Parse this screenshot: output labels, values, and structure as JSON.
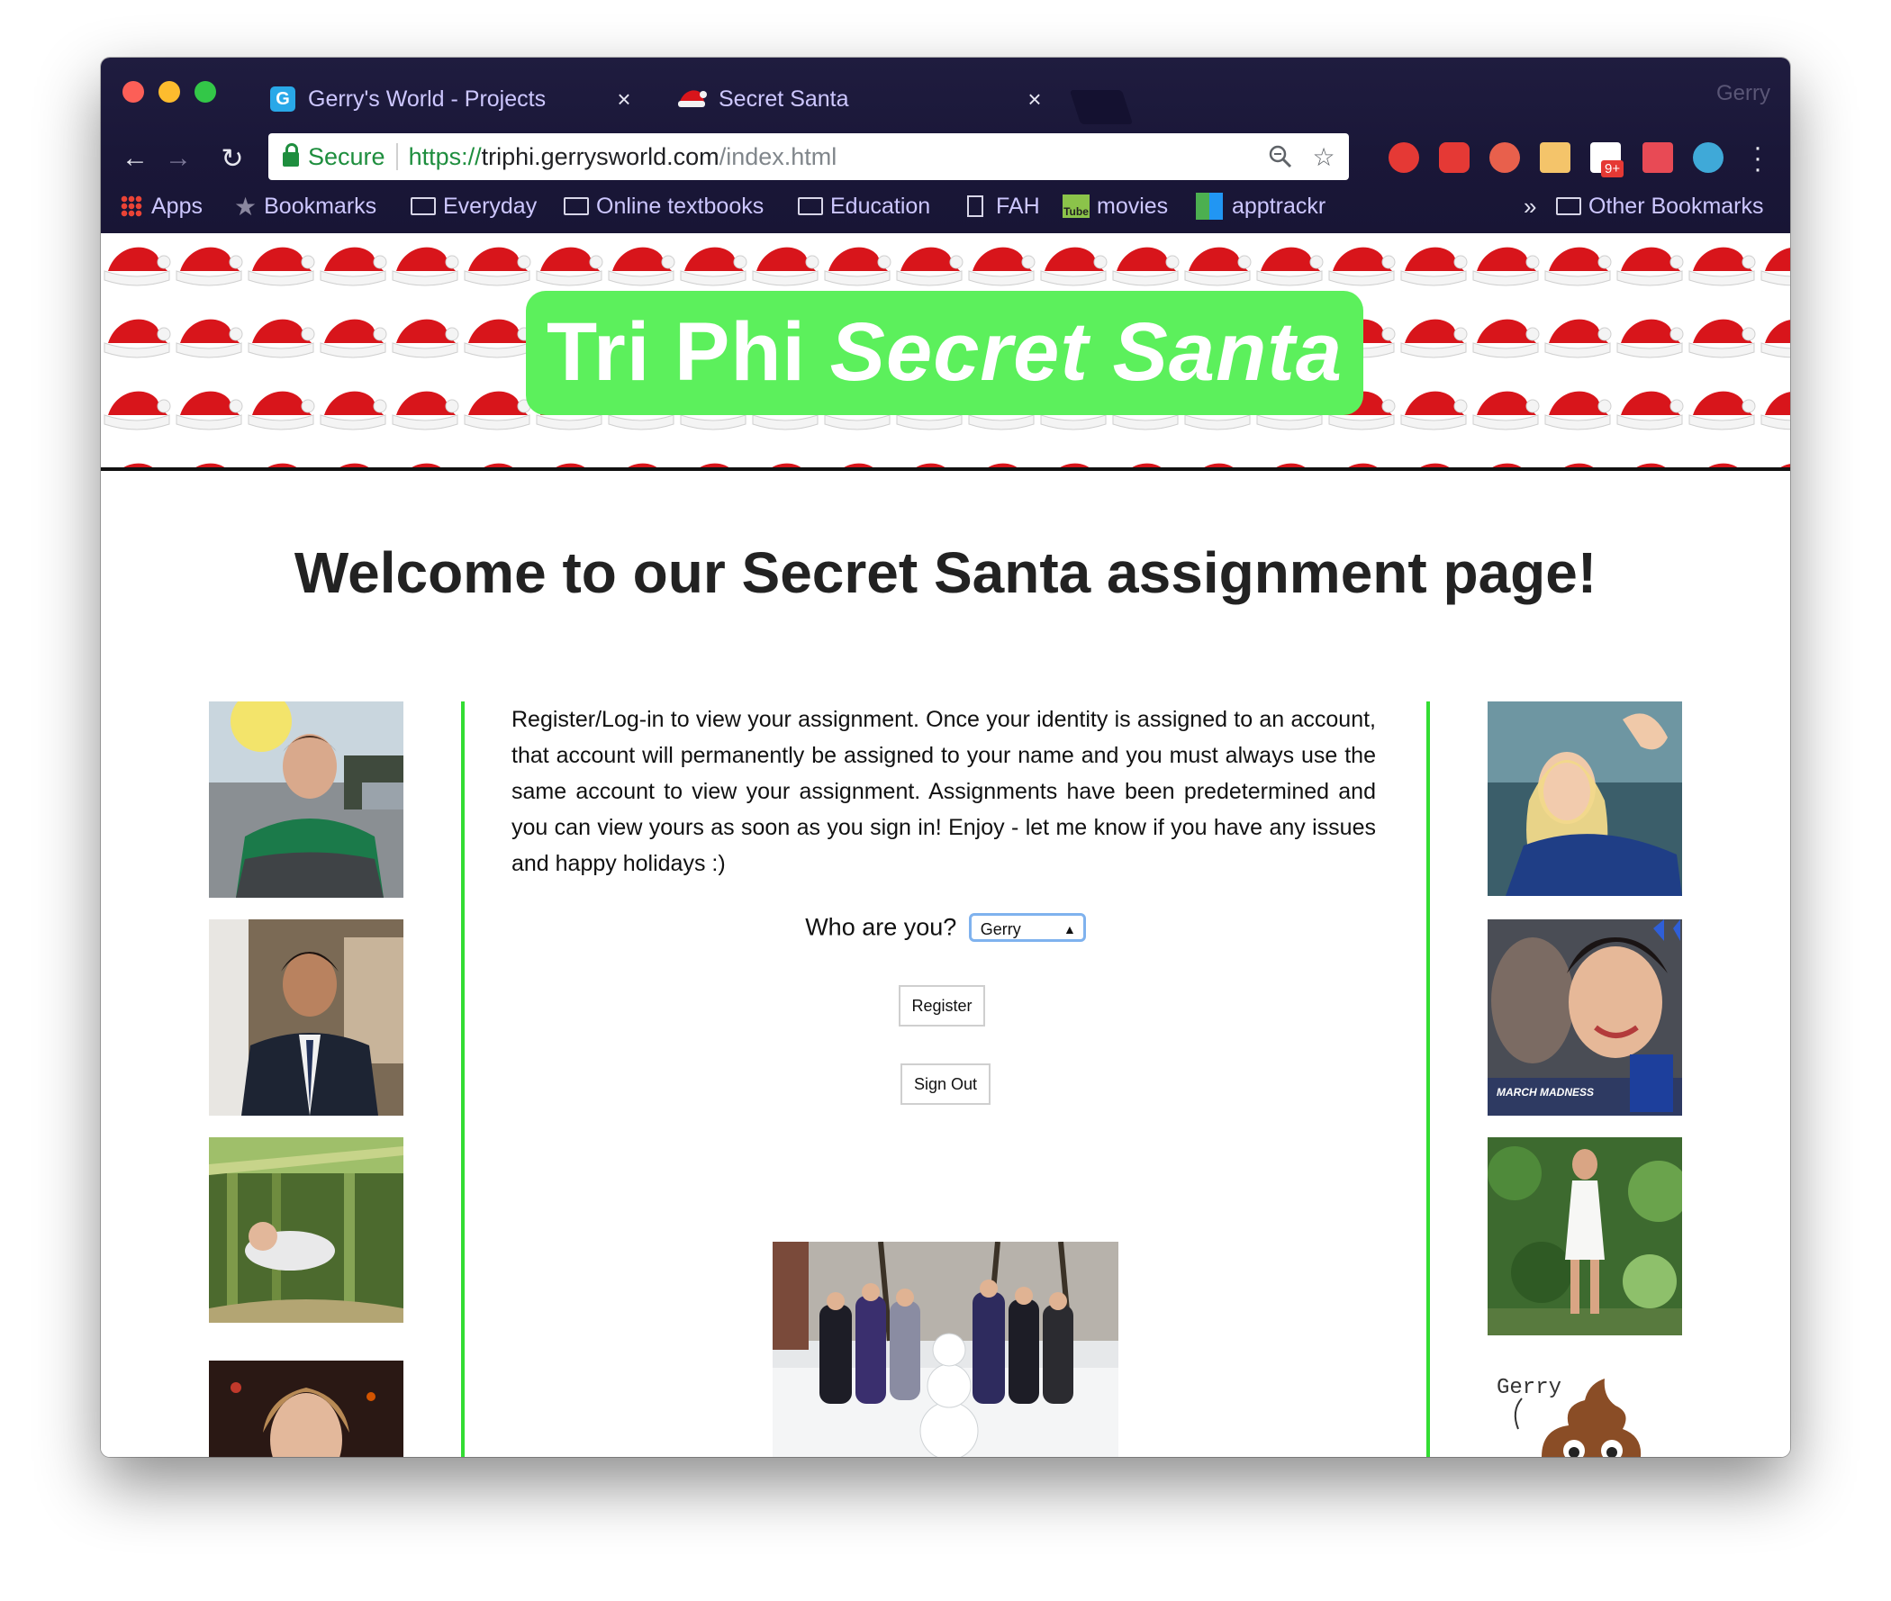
{
  "browser": {
    "tabs": [
      {
        "title": "Gerry's World - Projects",
        "icon": "g-favicon-icon",
        "close": "×"
      },
      {
        "title": "Secret Santa",
        "icon": "santa-hat-icon",
        "close": "×"
      }
    ],
    "profile_name": "Gerry",
    "address_bar": {
      "security_label": "Secure",
      "scheme": "https://",
      "host": "triphi.gerrysworld.com",
      "path": "/index.html"
    },
    "nav": {
      "back": "←",
      "forward": "→",
      "reload": "↻"
    },
    "extension_badge": "9+",
    "bookmarks": [
      {
        "label": "Apps",
        "icon": "apps-grid-icon"
      },
      {
        "label": "Bookmarks",
        "icon": "star-icon"
      },
      {
        "label": "Everyday",
        "icon": "folder-icon"
      },
      {
        "label": "Online textbooks",
        "icon": "folder-icon"
      },
      {
        "label": "Education",
        "icon": "folder-icon"
      },
      {
        "label": "FAH",
        "icon": "file-icon"
      },
      {
        "label": "movies",
        "icon": "tube-icon"
      },
      {
        "label": "apptrackr",
        "icon": "apptrackr-icon"
      }
    ],
    "bookmarks_overflow": "»",
    "other_bookmarks": "Other Bookmarks"
  },
  "page": {
    "banner_title_plain": "Tri Phi ",
    "banner_title_italic": "Secret Santa",
    "heading": "Welcome to our Secret Santa assignment page!",
    "intro": "Register/Log-in to view your assignment. Once your identity is assigned to an account, that account will permanently be assigned to your name and you must always use the same account to view your assignment. Assignments have been predetermined and you can view yours as soon as you sign in! Enjoy - let me know if you have any issues and happy holidays :)",
    "who_label": "Who are you?",
    "who_selected": "Gerry",
    "register_label": "Register",
    "signout_label": "Sign Out",
    "poop_caption": "Gerry",
    "duke_text": "MARCH MADNESS"
  },
  "colors": {
    "banner_title_bg": "#5cf05c",
    "divider": "#33dd33",
    "secure_green": "#1e8e3e",
    "chrome_bg": "#1f1c3f"
  }
}
